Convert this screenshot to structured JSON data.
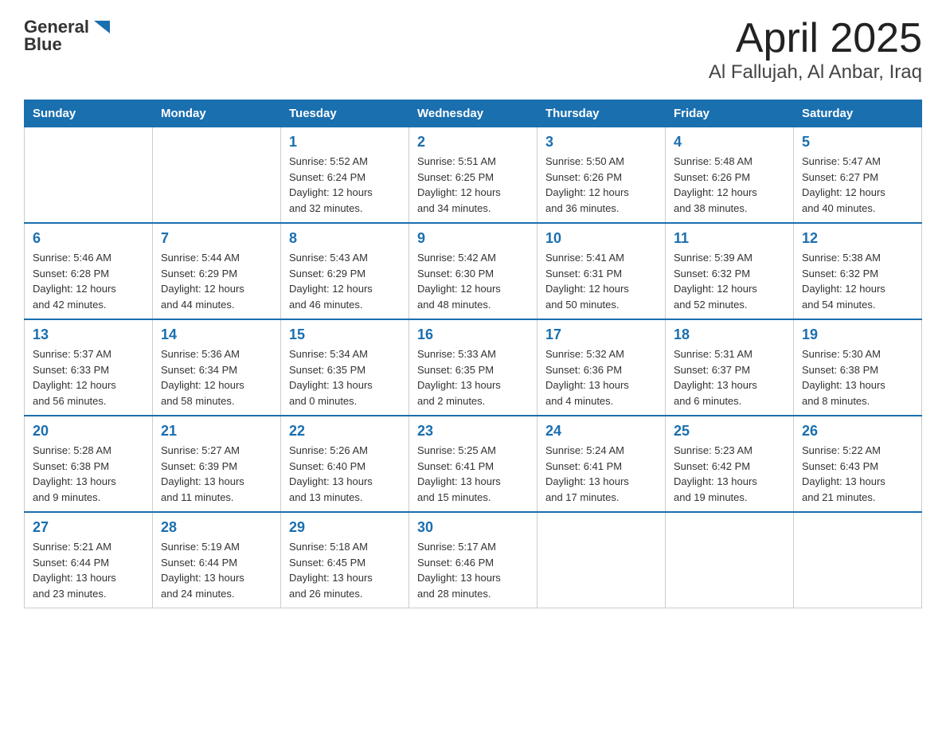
{
  "header": {
    "logo_general": "General",
    "logo_blue": "Blue",
    "month_title": "April 2025",
    "location": "Al Fallujah, Al Anbar, Iraq"
  },
  "days_of_week": [
    "Sunday",
    "Monday",
    "Tuesday",
    "Wednesday",
    "Thursday",
    "Friday",
    "Saturday"
  ],
  "weeks": [
    [
      {
        "day": "",
        "info": ""
      },
      {
        "day": "",
        "info": ""
      },
      {
        "day": "1",
        "info": "Sunrise: 5:52 AM\nSunset: 6:24 PM\nDaylight: 12 hours\nand 32 minutes."
      },
      {
        "day": "2",
        "info": "Sunrise: 5:51 AM\nSunset: 6:25 PM\nDaylight: 12 hours\nand 34 minutes."
      },
      {
        "day": "3",
        "info": "Sunrise: 5:50 AM\nSunset: 6:26 PM\nDaylight: 12 hours\nand 36 minutes."
      },
      {
        "day": "4",
        "info": "Sunrise: 5:48 AM\nSunset: 6:26 PM\nDaylight: 12 hours\nand 38 minutes."
      },
      {
        "day": "5",
        "info": "Sunrise: 5:47 AM\nSunset: 6:27 PM\nDaylight: 12 hours\nand 40 minutes."
      }
    ],
    [
      {
        "day": "6",
        "info": "Sunrise: 5:46 AM\nSunset: 6:28 PM\nDaylight: 12 hours\nand 42 minutes."
      },
      {
        "day": "7",
        "info": "Sunrise: 5:44 AM\nSunset: 6:29 PM\nDaylight: 12 hours\nand 44 minutes."
      },
      {
        "day": "8",
        "info": "Sunrise: 5:43 AM\nSunset: 6:29 PM\nDaylight: 12 hours\nand 46 minutes."
      },
      {
        "day": "9",
        "info": "Sunrise: 5:42 AM\nSunset: 6:30 PM\nDaylight: 12 hours\nand 48 minutes."
      },
      {
        "day": "10",
        "info": "Sunrise: 5:41 AM\nSunset: 6:31 PM\nDaylight: 12 hours\nand 50 minutes."
      },
      {
        "day": "11",
        "info": "Sunrise: 5:39 AM\nSunset: 6:32 PM\nDaylight: 12 hours\nand 52 minutes."
      },
      {
        "day": "12",
        "info": "Sunrise: 5:38 AM\nSunset: 6:32 PM\nDaylight: 12 hours\nand 54 minutes."
      }
    ],
    [
      {
        "day": "13",
        "info": "Sunrise: 5:37 AM\nSunset: 6:33 PM\nDaylight: 12 hours\nand 56 minutes."
      },
      {
        "day": "14",
        "info": "Sunrise: 5:36 AM\nSunset: 6:34 PM\nDaylight: 12 hours\nand 58 minutes."
      },
      {
        "day": "15",
        "info": "Sunrise: 5:34 AM\nSunset: 6:35 PM\nDaylight: 13 hours\nand 0 minutes."
      },
      {
        "day": "16",
        "info": "Sunrise: 5:33 AM\nSunset: 6:35 PM\nDaylight: 13 hours\nand 2 minutes."
      },
      {
        "day": "17",
        "info": "Sunrise: 5:32 AM\nSunset: 6:36 PM\nDaylight: 13 hours\nand 4 minutes."
      },
      {
        "day": "18",
        "info": "Sunrise: 5:31 AM\nSunset: 6:37 PM\nDaylight: 13 hours\nand 6 minutes."
      },
      {
        "day": "19",
        "info": "Sunrise: 5:30 AM\nSunset: 6:38 PM\nDaylight: 13 hours\nand 8 minutes."
      }
    ],
    [
      {
        "day": "20",
        "info": "Sunrise: 5:28 AM\nSunset: 6:38 PM\nDaylight: 13 hours\nand 9 minutes."
      },
      {
        "day": "21",
        "info": "Sunrise: 5:27 AM\nSunset: 6:39 PM\nDaylight: 13 hours\nand 11 minutes."
      },
      {
        "day": "22",
        "info": "Sunrise: 5:26 AM\nSunset: 6:40 PM\nDaylight: 13 hours\nand 13 minutes."
      },
      {
        "day": "23",
        "info": "Sunrise: 5:25 AM\nSunset: 6:41 PM\nDaylight: 13 hours\nand 15 minutes."
      },
      {
        "day": "24",
        "info": "Sunrise: 5:24 AM\nSunset: 6:41 PM\nDaylight: 13 hours\nand 17 minutes."
      },
      {
        "day": "25",
        "info": "Sunrise: 5:23 AM\nSunset: 6:42 PM\nDaylight: 13 hours\nand 19 minutes."
      },
      {
        "day": "26",
        "info": "Sunrise: 5:22 AM\nSunset: 6:43 PM\nDaylight: 13 hours\nand 21 minutes."
      }
    ],
    [
      {
        "day": "27",
        "info": "Sunrise: 5:21 AM\nSunset: 6:44 PM\nDaylight: 13 hours\nand 23 minutes."
      },
      {
        "day": "28",
        "info": "Sunrise: 5:19 AM\nSunset: 6:44 PM\nDaylight: 13 hours\nand 24 minutes."
      },
      {
        "day": "29",
        "info": "Sunrise: 5:18 AM\nSunset: 6:45 PM\nDaylight: 13 hours\nand 26 minutes."
      },
      {
        "day": "30",
        "info": "Sunrise: 5:17 AM\nSunset: 6:46 PM\nDaylight: 13 hours\nand 28 minutes."
      },
      {
        "day": "",
        "info": ""
      },
      {
        "day": "",
        "info": ""
      },
      {
        "day": "",
        "info": ""
      }
    ]
  ]
}
